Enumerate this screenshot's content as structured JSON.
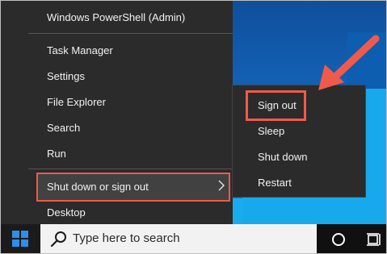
{
  "menu": {
    "items": [
      {
        "label": "Windows PowerShell (Admin)"
      },
      {
        "label": "Task Manager"
      },
      {
        "label": "Settings"
      },
      {
        "label": "File Explorer"
      },
      {
        "label": "Search"
      },
      {
        "label": "Run"
      },
      {
        "label": "Shut down or sign out",
        "selected": true,
        "has_submenu": true
      },
      {
        "label": "Desktop"
      }
    ]
  },
  "submenu": {
    "items": [
      {
        "label": "Sign out",
        "highlighted": true
      },
      {
        "label": "Sleep"
      },
      {
        "label": "Shut down"
      },
      {
        "label": "Restart"
      }
    ]
  },
  "taskbar": {
    "search_placeholder": "Type here to search",
    "icons": [
      "windows-start-icon",
      "search-icon",
      "cortana-icon",
      "task-view-icon"
    ]
  },
  "annotation": {
    "color": "#f05a4a",
    "arrow_target": "Sign out"
  },
  "colors": {
    "menu_bg": "#2b2b2b",
    "menu_text": "#f2f2f2",
    "selected_bg": "#414141",
    "accent": "#f05a4a",
    "taskbar_bg": "#101010"
  }
}
